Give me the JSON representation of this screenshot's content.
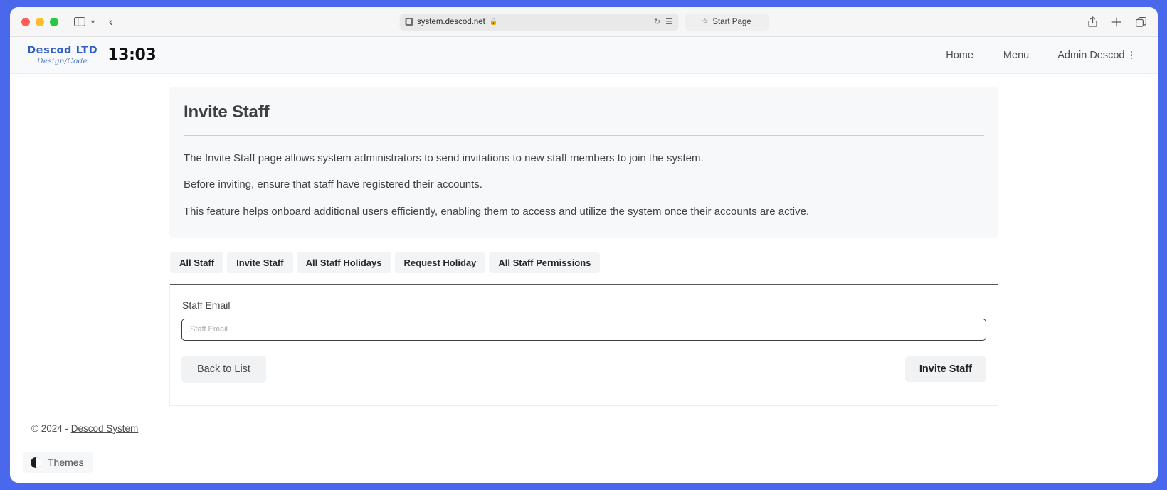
{
  "browser": {
    "url": "system.descod.net",
    "url_security_icon": "shield-icon",
    "lock_icon": "lock-icon",
    "reload_icon": "reload-icon",
    "reader_icon": "reader-view-icon",
    "tab_title": "Start Page",
    "tab_star_icon": "star-icon",
    "sidebar_icon": "sidebar-toggle-icon",
    "chevron_icon": "chevron-down-icon",
    "back_icon": "back-chevron-icon",
    "share_icon": "share-icon",
    "new_tab_icon": "plus-icon",
    "tab_overview_icon": "tab-overview-icon"
  },
  "navbar": {
    "logo_main": "Descod LTD",
    "logo_sub": "Design/Code",
    "clock": "13:03",
    "links": [
      {
        "label": "Home"
      },
      {
        "label": "Menu"
      }
    ],
    "user": {
      "label": "Admin Descod",
      "menu_icon": "kebab-menu-icon"
    }
  },
  "page": {
    "title": "Invite Staff",
    "info_lines": [
      "The Invite Staff page allows system administrators to send invitations to new staff members to join the system.",
      "Before inviting, ensure that staff have registered their accounts.",
      "This feature helps onboard additional users efficiently, enabling them to access and utilize the system once their accounts are active."
    ]
  },
  "tabs": [
    {
      "label": "All Staff"
    },
    {
      "label": "Invite Staff"
    },
    {
      "label": "All Staff Holidays"
    },
    {
      "label": "Request Holiday"
    },
    {
      "label": "All Staff Permissions"
    }
  ],
  "form": {
    "email_label": "Staff Email",
    "email_placeholder": "Staff Email",
    "email_value": "",
    "back_button": "Back to List",
    "submit_button": "Invite Staff"
  },
  "footer": {
    "copyright": "© 2024 - ",
    "link": "Descod System"
  },
  "themes": {
    "label": "Themes",
    "icon": "half-circle-theme-icon"
  },
  "colors": {
    "desktop": "#4968ec",
    "brand": "#2f5fc4",
    "info_card": "#f7f8f9",
    "navbar": "#f8f9fa",
    "rule": "#54575b"
  }
}
